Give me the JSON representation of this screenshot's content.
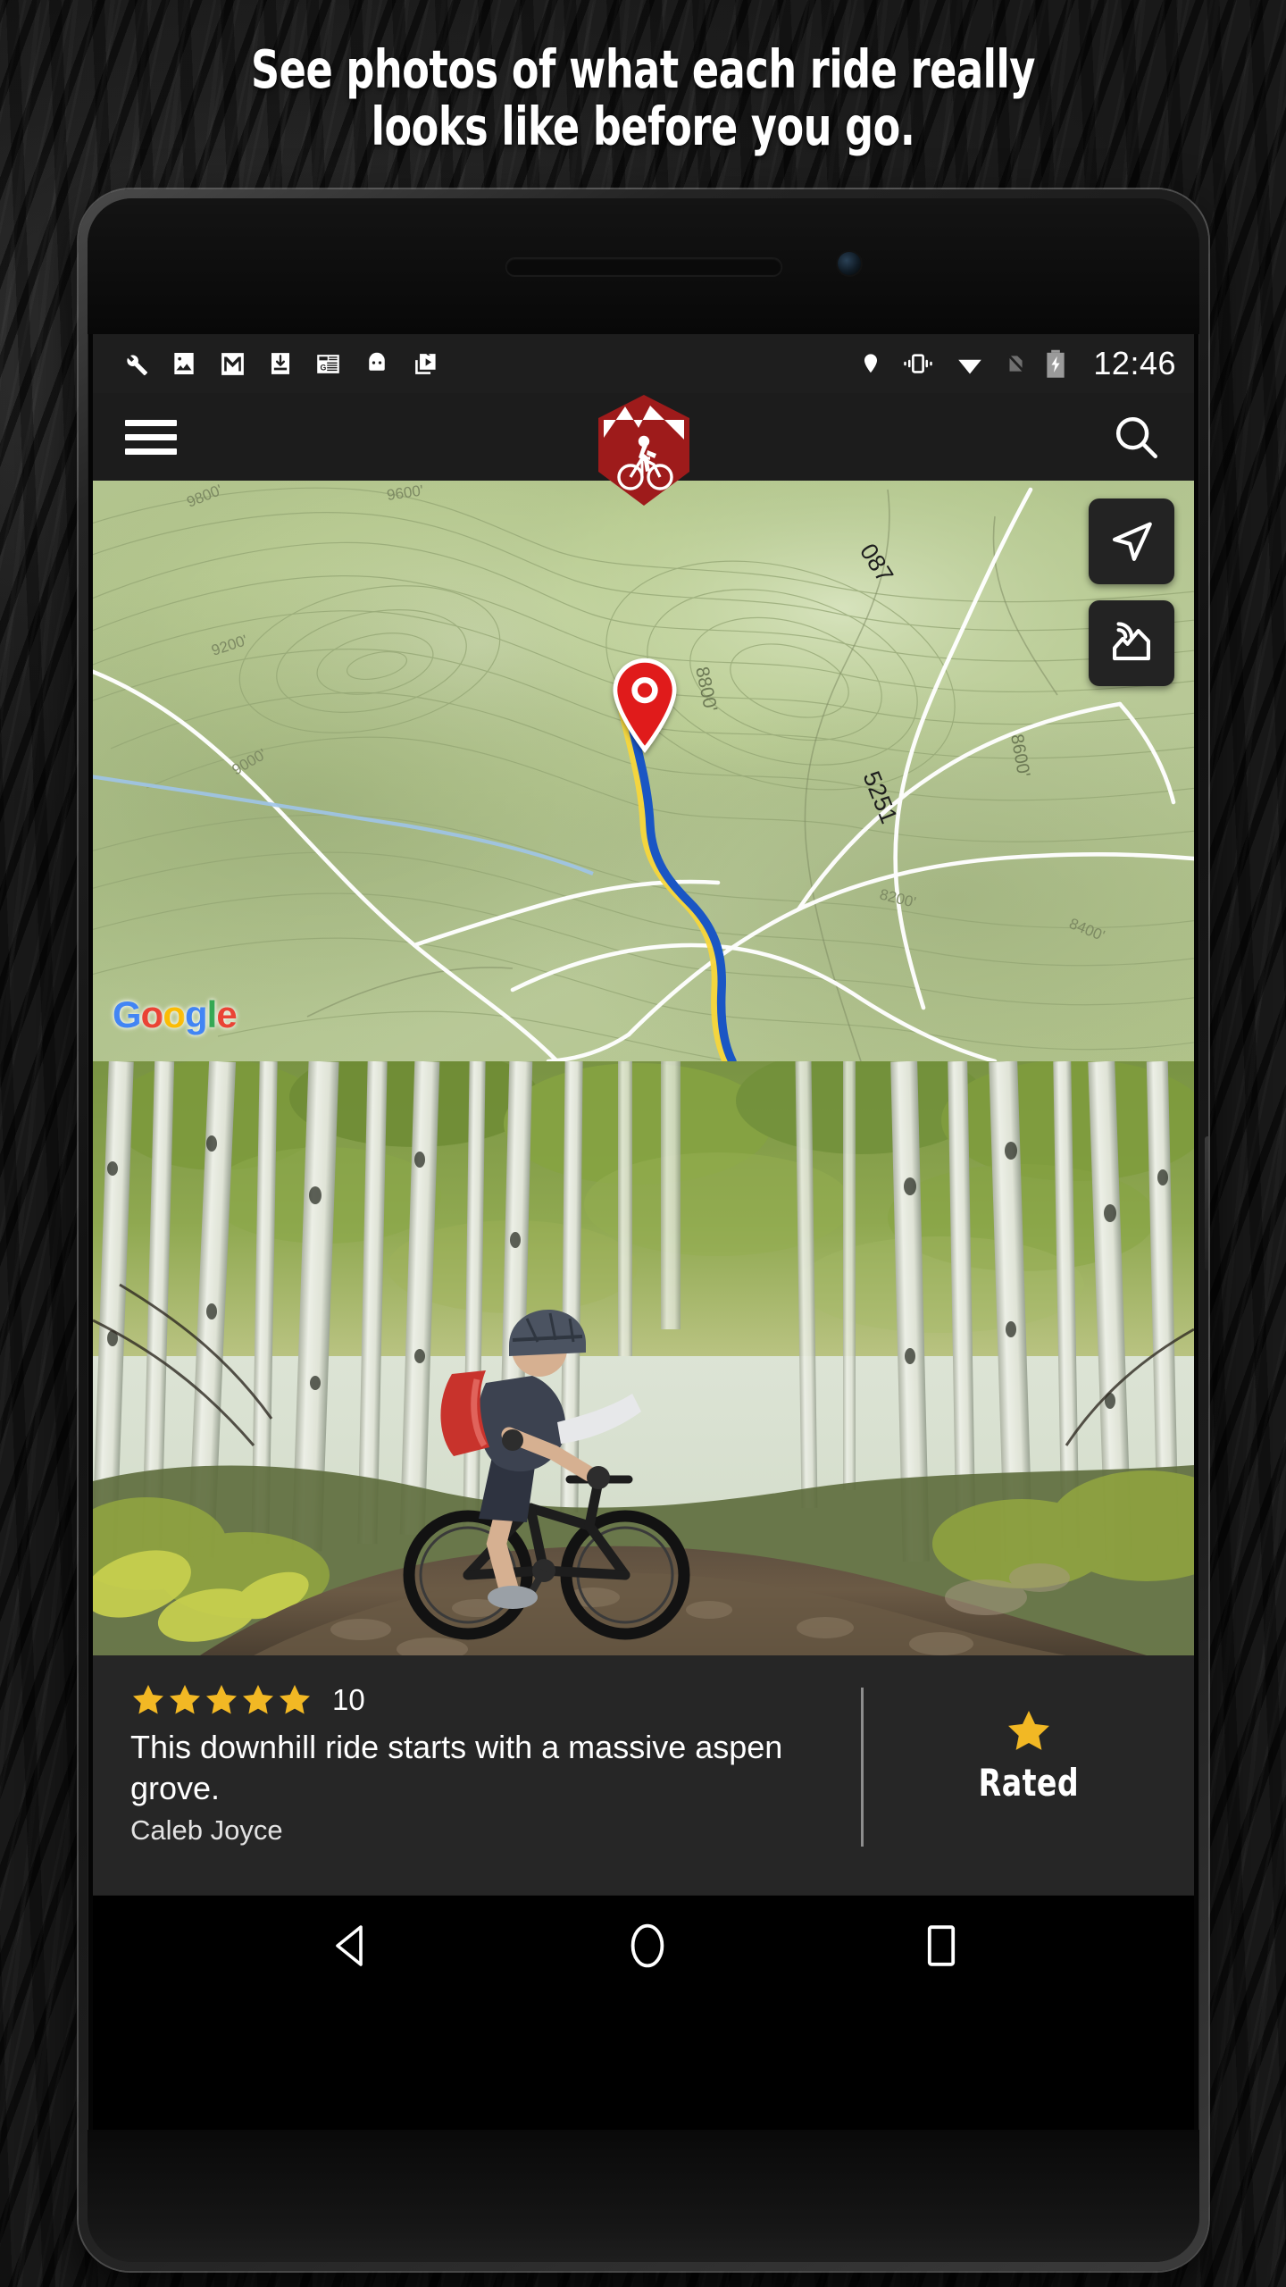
{
  "promo": {
    "headline_line1": "See photos of what each ride really",
    "headline_line2": "looks like before you go."
  },
  "statusbar": {
    "time": "12:46",
    "notification_icons": [
      "wrench-icon",
      "photo-icon",
      "gmail-icon",
      "download-icon",
      "google-news-icon",
      "android-icon",
      "play-movies-icon"
    ],
    "system_icons": [
      "location-icon",
      "vibrate-icon",
      "wifi-icon",
      "no-sim-icon",
      "battery-charging-icon"
    ]
  },
  "appbar": {
    "menu_label": "Menu",
    "search_label": "Search",
    "logo_label": "MTB Project"
  },
  "map": {
    "attribution": {
      "g1": "G",
      "o1": "o",
      "o2": "o",
      "g2": "g",
      "l": "l",
      "e": "e"
    },
    "labels": {
      "road_087": "087",
      "contour_8800": "8800'",
      "contour_8600": "8600'",
      "trail_5251": "5251"
    },
    "buttons": [
      {
        "name": "locate-me-button",
        "icon": "navigation-arrow-icon"
      },
      {
        "name": "map-layers-button",
        "icon": "photo-terrain-icon"
      }
    ],
    "marker_label": "Selected trail location"
  },
  "photo": {
    "alt": "Mountain biker riding a dirt trail through a dense aspen grove"
  },
  "info": {
    "rating_stars": 5,
    "rating_count": "10",
    "description": "This downhill ride starts with a massive aspen grove.",
    "author": "Caleb Joyce",
    "rated_label": "Rated"
  },
  "navbar": {
    "back_label": "Back",
    "home_label": "Home",
    "recents_label": "Recents"
  },
  "colors": {
    "brand_red": "#9E1B1B",
    "star_gold": "#F2B824",
    "panel_bg": "#262626",
    "appbar_bg": "#1C1C1C",
    "map_green": "#c5d6a0"
  }
}
